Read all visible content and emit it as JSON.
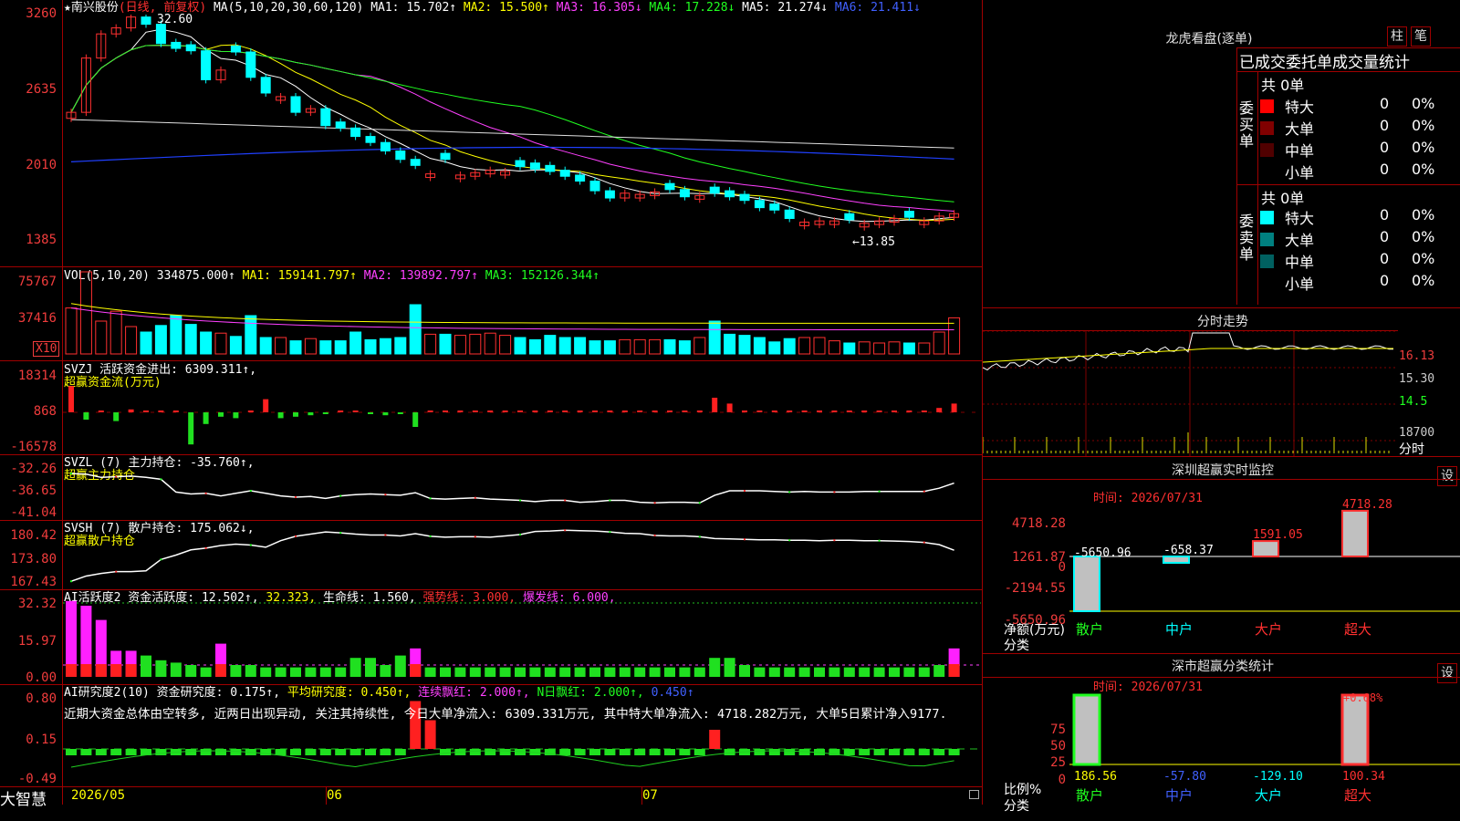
{
  "stock": {
    "star": "★",
    "name": "南兴股份",
    "period": "(日线, 前复权)",
    "ma_label": "MA(5,10,20,30,60,120)"
  },
  "ma": [
    {
      "label": "MA1:",
      "value": "15.702↑",
      "color": "#ffffff"
    },
    {
      "label": "MA2:",
      "value": "15.500↑",
      "color": "#ffff00"
    },
    {
      "label": "MA3:",
      "value": "16.305↓",
      "color": "#ff40ff"
    },
    {
      "label": "MA4:",
      "value": "17.228↓",
      "color": "#20ff20"
    },
    {
      "label": "MA5:",
      "value": "21.274↓",
      "color": "#ffffff"
    },
    {
      "label": "MA6:",
      "value": "21.411↓",
      "color": "#4060ff"
    }
  ],
  "price_axis": [
    "3260",
    "2635",
    "2010",
    "1385"
  ],
  "price_marks": {
    "high": "32.60",
    "low": "←13.85"
  },
  "vol": {
    "label": "VOL(5,10,20)",
    "value": "334875.000↑",
    "ma1": "MA1: 159141.797↑",
    "ma2": "MA2: 139892.797↑",
    "ma3": "MA3: 152126.344↑",
    "axis": [
      "75767",
      "37416"
    ],
    "unit": "X10"
  },
  "svzj": {
    "label": "SVZJ  活跃资金进出: 6309.311↑,",
    "sub": "超赢资金流(万元)",
    "axis": [
      "18314",
      "868",
      "-16578"
    ]
  },
  "svzl": {
    "label": "SVZL (7) 主力持仓: -35.760↑,",
    "sub": "超赢主力持仓",
    "axis": [
      "-32.26",
      "-36.65",
      "-41.04"
    ]
  },
  "svsh": {
    "label": "SVSH (7) 散户持仓: 175.062↓,",
    "sub": "超赢散户持仓",
    "axis": [
      "180.42",
      "173.80",
      "167.43"
    ]
  },
  "ai1": {
    "label": "AI活跃度2 资金活跃度: 12.502↑,",
    "v2": "32.323,",
    "v3": "生命线: 1.560,",
    "v4": "强势线: 3.000,",
    "v5": "爆发线: 6.000,",
    "axis": [
      "32.32",
      "15.97",
      "0.00"
    ]
  },
  "ai2": {
    "label": "AI研究度2(10) 资金研究度: 0.175↑,",
    "v2": "平均研究度: 0.450↑,",
    "v3": "连续飘红: 2.000↑,",
    "v4": "N日飘红: 2.000↑,",
    "v5": "0.450↑",
    "axis": [
      "0.80",
      "0.15",
      "-0.49"
    ],
    "comment": "近期大资金总体由空转多, 近两日出现异动, 关注其持续性, 今日大单净流入: 6309.331万元, 其中特大单净流入: 4718.282万元, 大单5日累计净入9177."
  },
  "bottom": {
    "brand": "大智慧",
    "dates": [
      "2026/05",
      "06",
      "07"
    ]
  },
  "lhb": {
    "title": "龙虎看盘(逐单)",
    "tab1": "柱",
    "tab2": "笔",
    "header": "已成交委托单成交量统计",
    "buy": {
      "side": "委买单",
      "total": "共 0单",
      "rows": [
        {
          "name": "特大",
          "n": "0",
          "p": "0%",
          "color": "#ff0000"
        },
        {
          "name": "大单",
          "n": "0",
          "p": "0%",
          "color": "#800000"
        },
        {
          "name": "中单",
          "n": "0",
          "p": "0%",
          "color": "#500000"
        },
        {
          "name": "小单",
          "n": "0",
          "p": "0%",
          "color": ""
        }
      ]
    },
    "sell": {
      "side": "委卖单",
      "total": "共 0单",
      "rows": [
        {
          "name": "特大",
          "n": "0",
          "p": "0%",
          "color": "#00ffff"
        },
        {
          "name": "大单",
          "n": "0",
          "p": "0%",
          "color": "#008080"
        },
        {
          "name": "中单",
          "n": "0",
          "p": "0%",
          "color": "#006060"
        },
        {
          "name": "小单",
          "n": "0",
          "p": "0%",
          "color": ""
        }
      ]
    }
  },
  "fenshi": {
    "title": "分时走势",
    "axis": [
      "16.13",
      "15.30",
      "14.5",
      "18700",
      "分时"
    ]
  },
  "monitor": {
    "title": "深圳超赢实时监控",
    "btn": "设",
    "date": "时间: 2026/07/31",
    "axis": [
      "4718.28",
      "1261.87",
      "0",
      "-2194.55",
      "-5650.96"
    ],
    "ylabel": "净额(万元)",
    "xlabel": "分类",
    "bars": [
      {
        "cat": "散户",
        "value": "-5650.96"
      },
      {
        "cat": "中户",
        "value": "-658.37"
      },
      {
        "cat": "大户",
        "value": "1591.05"
      },
      {
        "cat": "超大",
        "value": "4718.28"
      }
    ]
  },
  "category": {
    "title": "深市超赢分类统计",
    "btn": "设",
    "date": "时间: 2026/07/31",
    "axis": [
      "75",
      "50",
      "25",
      "0"
    ],
    "ylabel": "比例%",
    "xlabel": "分类",
    "top_label": "+0.68%",
    "bars": [
      {
        "cat": "散户",
        "value": "186.56"
      },
      {
        "cat": "中户",
        "value": "-57.80"
      },
      {
        "cat": "大户",
        "value": "-129.10"
      },
      {
        "cat": "超大",
        "value": "100.34"
      }
    ]
  },
  "chart_data": [
    {
      "type": "candlestick",
      "title": "南兴股份 (日线, 前复权)",
      "y_ticks": [
        32.6,
        26.35,
        20.1,
        13.85
      ],
      "high": 32.6,
      "low": 13.85,
      "closes": [
        24.5,
        29,
        31,
        31.5,
        32.4,
        31.8,
        30.2,
        29.8,
        29.6,
        27.2,
        28,
        29.5,
        27.4,
        26.1,
        25.8,
        24.5,
        24.8,
        23.4,
        23.2,
        22.5,
        22,
        21.3,
        20.6,
        20.1,
        19.4,
        20.6,
        19.3,
        19.5,
        19.7,
        19.6,
        20,
        19.8,
        19.6,
        19.2,
        18.8,
        18,
        17.4,
        17.8,
        17.7,
        17.9,
        18.1,
        17.5,
        17.6,
        17.8,
        17.5,
        17.2,
        16.6,
        16.4,
        15.7,
        15.4,
        15.5,
        15.5,
        15.6,
        15.3,
        15.5,
        15.7,
        15.8,
        15.5,
        15.9,
        16.1
      ],
      "up": [
        1,
        1,
        1,
        1,
        1,
        0,
        0,
        0,
        0,
        0,
        1,
        0,
        0,
        0,
        1,
        0,
        1,
        0,
        0,
        0,
        0,
        0,
        0,
        0,
        1,
        0,
        1,
        1,
        1,
        1,
        0,
        0,
        0,
        0,
        0,
        0,
        0,
        1,
        1,
        1,
        0,
        0,
        1,
        0,
        0,
        0,
        0,
        0,
        0,
        1,
        1,
        1,
        0,
        1,
        1,
        1,
        0,
        1,
        1,
        1
      ]
    },
    {
      "type": "bar",
      "title": "VOL(5,10,20)",
      "y_ticks": [
        75767,
        37416
      ],
      "values": [
        42,
        75,
        30,
        39,
        25,
        20,
        26,
        35,
        27,
        20,
        19,
        16,
        35,
        15,
        15,
        12,
        14,
        12,
        12,
        20,
        13,
        14,
        15,
        45,
        18,
        18,
        17,
        18,
        19,
        17,
        15,
        13,
        17,
        15,
        15,
        12,
        12,
        13,
        13,
        13,
        13,
        12,
        15,
        30,
        18,
        17,
        15,
        11,
        14,
        15,
        15,
        12,
        10,
        11,
        10,
        11,
        10,
        10,
        20,
        33
      ]
    },
    {
      "type": "bar",
      "title": "SVZJ 活跃资金进出",
      "y_ticks": [
        18314,
        868,
        -16578
      ],
      "values": [
        18,
        -5,
        0,
        -6,
        2,
        0,
        0,
        0,
        -22,
        -8,
        -3,
        -4,
        0,
        9,
        -4,
        -3,
        -2,
        -1,
        0,
        0,
        -1,
        -2,
        -1,
        -10,
        0,
        0,
        0,
        0,
        0,
        0,
        0,
        0,
        0,
        0,
        0,
        0,
        0,
        0,
        0,
        0,
        0,
        0,
        0,
        10,
        6,
        0,
        0,
        0,
        0,
        0,
        0,
        0,
        0,
        0,
        0,
        0,
        0,
        0,
        3,
        6
      ]
    },
    {
      "type": "line",
      "title": "SVZL 主力持仓",
      "y_ticks": [
        -32.26,
        -36.65,
        -41.04
      ],
      "values": [
        -34.3,
        -34.4,
        -34.9,
        -34.8,
        -34.7,
        -34.9,
        -35.2,
        -37.2,
        -37.5,
        -37.4,
        -37.8,
        -37.4,
        -37,
        -37.4,
        -37.8,
        -38,
        -37.9,
        -38.2,
        -37.8,
        -37.6,
        -37.5,
        -37.6,
        -37.7,
        -37.3,
        -38.2,
        -38.3,
        -38.2,
        -38.1,
        -38.3,
        -38.4,
        -38.5,
        -38.7,
        -38.5,
        -38.5,
        -38.8,
        -38.7,
        -38.5,
        -38.5,
        -38.8,
        -38.9,
        -38.8,
        -38.8,
        -38.9,
        -37.7,
        -37,
        -37,
        -37,
        -37.1,
        -37.2,
        -37.1,
        -37.2,
        -37.2,
        -37.2,
        -37.1,
        -37.1,
        -37.1,
        -37.1,
        -37.1,
        -36.6,
        -35.8
      ]
    },
    {
      "type": "line",
      "title": "SVSH 散户持仓",
      "y_ticks": [
        180.42,
        173.8,
        167.43
      ],
      "values": [
        168,
        169.2,
        169.8,
        170.2,
        170.2,
        170.4,
        173,
        174,
        175.2,
        175.6,
        176.2,
        176.5,
        176.3,
        175.8,
        177.3,
        178.3,
        178.8,
        179.3,
        179.1,
        178.8,
        178.6,
        178.6,
        178.4,
        178.9,
        178.3,
        178.1,
        178.2,
        178.2,
        178.1,
        178.4,
        178.7,
        179.4,
        179.5,
        179.7,
        179.6,
        179.5,
        179.3,
        179,
        178.9,
        178.5,
        178.4,
        178.4,
        178.2,
        177.8,
        177.7,
        177.6,
        177.5,
        177.5,
        177.4,
        177.4,
        177.3,
        177.4,
        177.4,
        177.3,
        177.3,
        177.2,
        177.1,
        176.9,
        176.4,
        175.1
      ]
    },
    {
      "type": "bar",
      "title": "AI活跃度2",
      "y_ticks": [
        32.32,
        15.97,
        0.0
      ],
      "values": [
        32,
        30,
        24,
        11,
        11,
        9,
        7,
        6,
        5,
        4,
        14,
        5,
        5,
        4,
        4,
        4,
        4,
        4,
        4,
        8,
        8,
        5,
        9,
        12,
        4,
        4,
        4,
        4,
        4,
        4,
        4,
        4,
        4,
        4,
        4,
        4,
        4,
        4,
        4,
        4,
        4,
        4,
        4,
        8,
        8,
        5,
        4,
        4,
        4,
        4,
        4,
        4,
        4,
        4,
        4,
        4,
        4,
        4,
        5,
        12
      ]
    },
    {
      "type": "bar",
      "title": "AI研究度2(10)",
      "y_ticks": [
        0.8,
        0.15,
        -0.49
      ],
      "values": [
        0.15,
        0.12,
        0.12,
        0.08,
        0.12,
        0.12,
        0.1,
        0.08,
        0.06,
        0.05,
        0.15,
        0.05,
        0.05,
        0.06,
        0.06,
        0.08,
        0.08,
        0.08,
        0.08,
        0.08,
        0.08,
        0.08,
        0.08,
        0.75,
        0.45,
        0.1,
        0.08,
        0.08,
        0.08,
        0.08,
        0.08,
        0.08,
        0.08,
        0.08,
        0.08,
        0.08,
        0.08,
        0.08,
        0.08,
        0.08,
        0.08,
        0.08,
        0.08,
        0.3,
        0.1,
        0.1,
        0.1,
        0.08,
        0.08,
        0.08,
        0.08,
        0.08,
        0.08,
        0.08,
        0.08,
        0.08,
        0.08,
        0.08,
        0.1,
        0.2
      ]
    }
  ]
}
